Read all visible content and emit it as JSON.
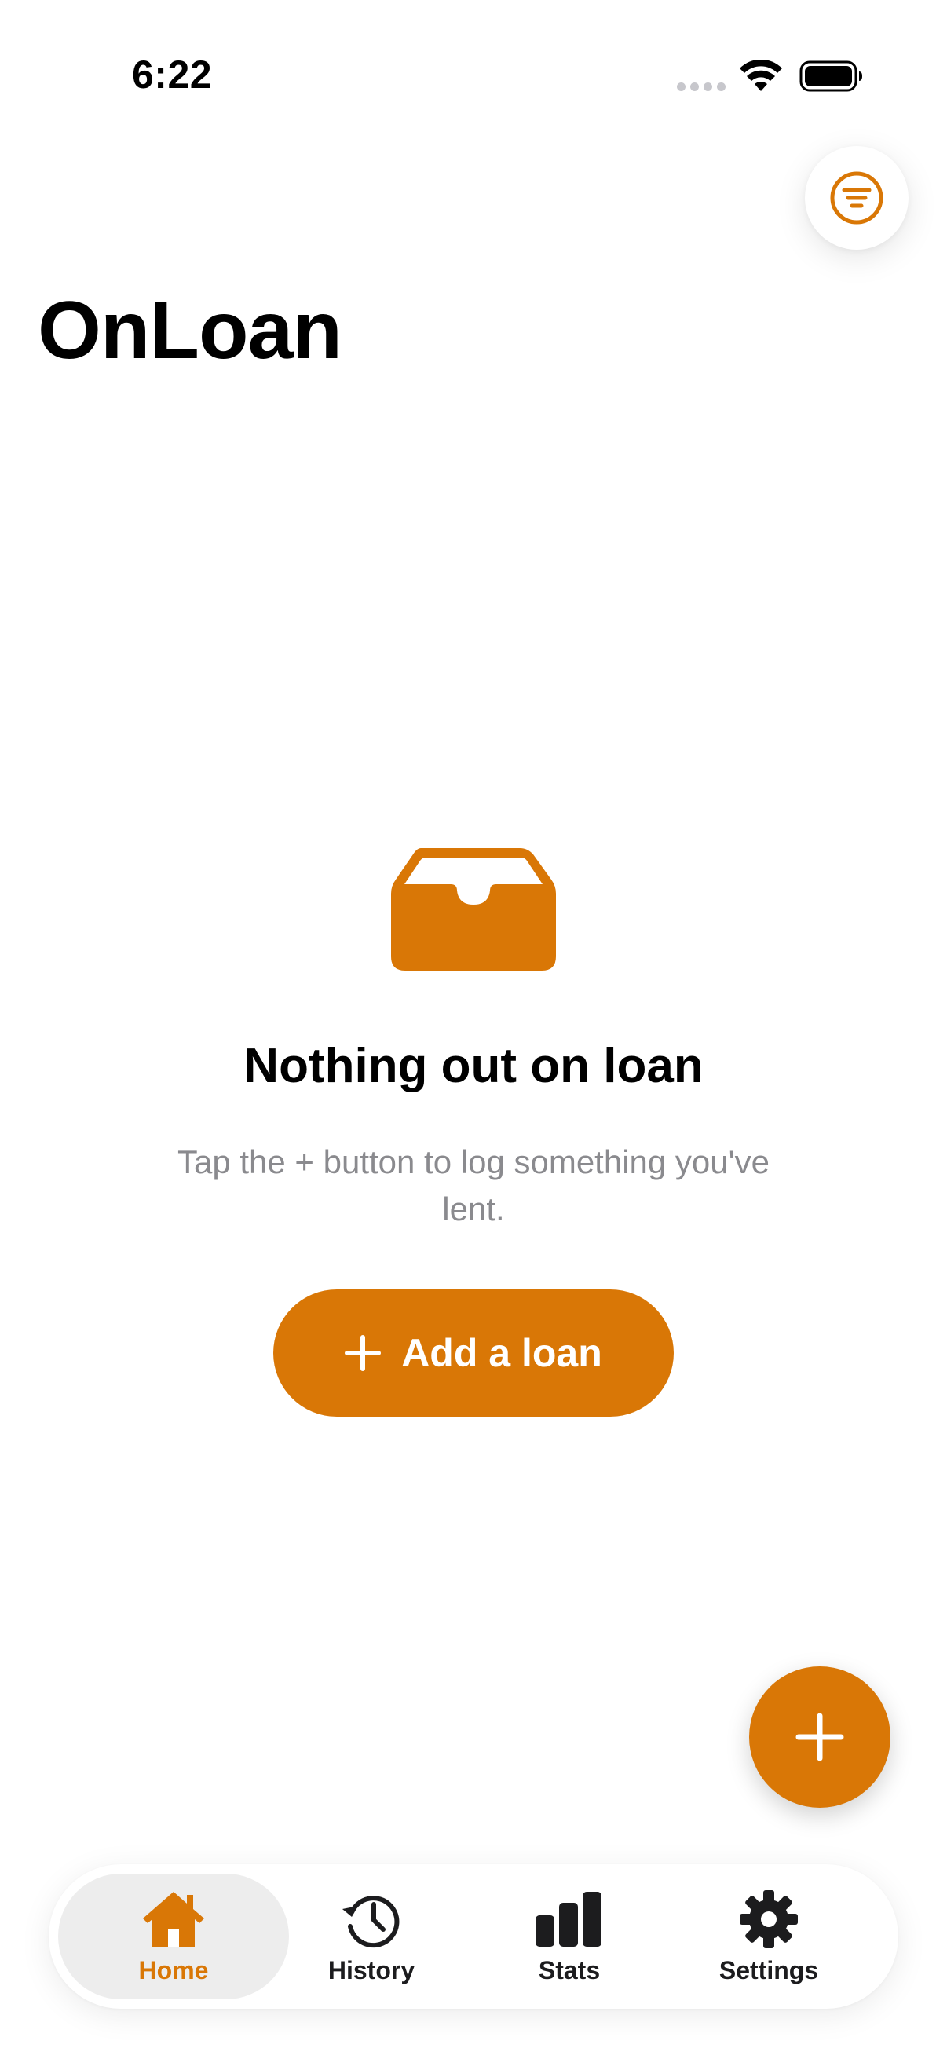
{
  "status_bar": {
    "time": "6:22"
  },
  "header": {
    "title": "OnLoan"
  },
  "empty_state": {
    "title": "Nothing out on loan",
    "subtitle": "Tap the + button to log something you've lent.",
    "button_label": "Add a loan"
  },
  "tab_bar": {
    "tabs": [
      {
        "label": "Home",
        "icon": "house-icon",
        "active": true
      },
      {
        "label": "History",
        "icon": "clock-history-icon",
        "active": false
      },
      {
        "label": "Stats",
        "icon": "bar-chart-icon",
        "active": false
      },
      {
        "label": "Settings",
        "icon": "gear-icon",
        "active": false
      }
    ]
  },
  "colors": {
    "accent": "#d97706",
    "subtitle_gray": "#8a8a8e",
    "tab_active_bg": "#ededed"
  }
}
